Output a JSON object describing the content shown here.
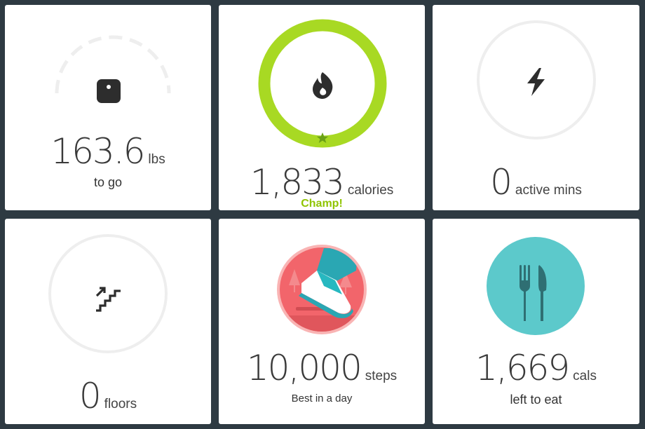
{
  "colors": {
    "background": "#2e3a42",
    "calorie_ring": "#a8d923",
    "champ_text": "#8fc400",
    "steps_badge": "#f2656b",
    "food_badge": "#5cc9cb",
    "empty_ring": "#eeeeee"
  },
  "tiles": [
    {
      "icon": "scale-icon",
      "value": "163.6",
      "unit": "lbs",
      "label": "to go"
    },
    {
      "icon": "flame-icon",
      "value": "1,833",
      "unit": "calories",
      "label": "Champ!",
      "progress": 1.0,
      "goal_met_icon": "star-icon"
    },
    {
      "icon": "lightning-icon",
      "value": "0",
      "unit": "active mins",
      "label": "",
      "progress": 0
    },
    {
      "icon": "stairs-icon",
      "value": "0",
      "unit": "floors",
      "label": "",
      "progress": 0
    },
    {
      "icon": "sneaker-badge-icon",
      "value": "10,000",
      "unit": "steps",
      "label": "Best in a day"
    },
    {
      "icon": "fork-knife-badge-icon",
      "value": "1,669",
      "unit": "cals",
      "label": "left to eat"
    }
  ]
}
